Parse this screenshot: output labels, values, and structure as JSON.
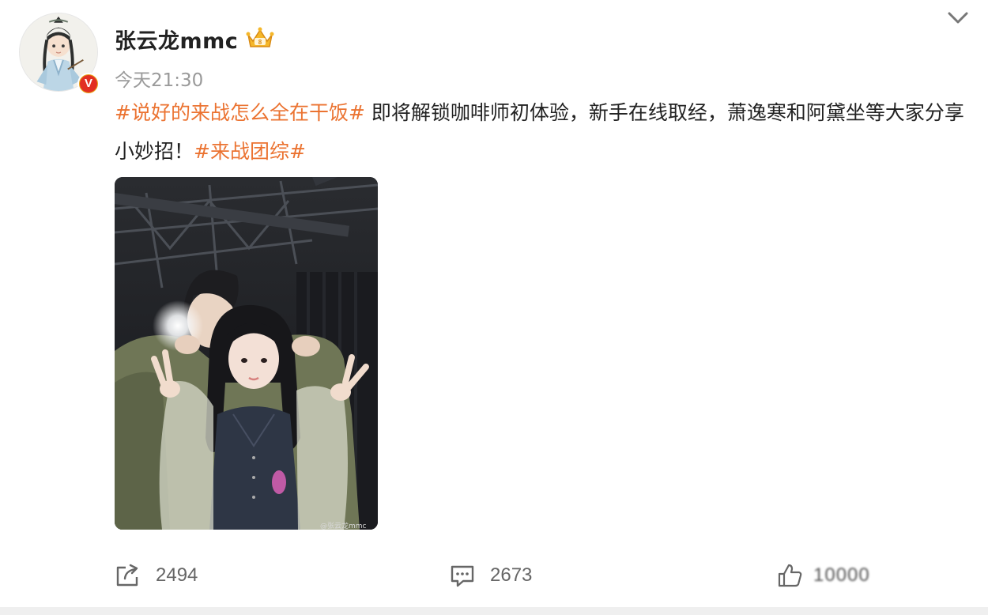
{
  "author": {
    "name": "张云龙mmc",
    "verified_badge": "V",
    "badge_color": "#e22f22",
    "crown_icon": "crown-icon"
  },
  "post": {
    "time": "今天21:30",
    "segments": [
      {
        "text": "#说好的来战怎么全在干饭#",
        "hashtag": true
      },
      {
        "text": " 即将解锁咖啡师初体验，新手在线取经，萧逸寒和阿黛坐等大家分享小妙招！",
        "hashtag": false
      },
      {
        "text": "#来战团综#",
        "hashtag": true
      }
    ],
    "hashtag_color": "#eb7331",
    "image_watermark": "@张云龙mmc"
  },
  "actions": {
    "repost_count": "2494",
    "comment_count": "2673",
    "like_count": "10000"
  },
  "icons": {
    "more": "chevron-down-icon",
    "repost": "repost-icon",
    "comment": "comment-icon",
    "like": "thumbs-up-icon"
  }
}
